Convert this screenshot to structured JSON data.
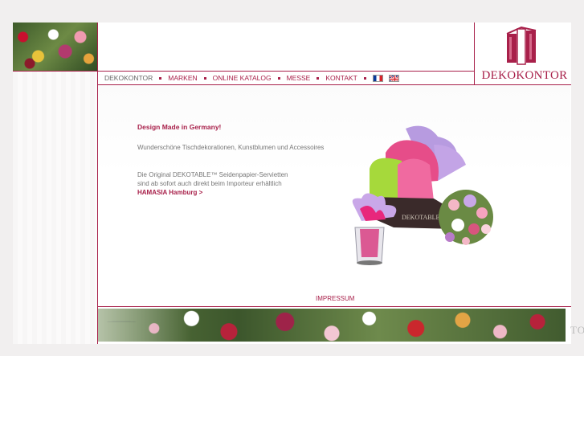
{
  "brand": {
    "logo_text": "DEKOKONTOR",
    "accent_color": "#a8204a"
  },
  "nav": {
    "items": [
      {
        "label": "DEKOKONTOR",
        "active": true
      },
      {
        "label": "MARKEN",
        "active": false
      },
      {
        "label": "ONLINE KATALOG",
        "active": false
      },
      {
        "label": "MESSE",
        "active": false
      },
      {
        "label": "KONTAKT",
        "active": false
      }
    ],
    "flags": [
      {
        "icon": "france-flag-icon"
      },
      {
        "icon": "uk-flag-icon"
      }
    ]
  },
  "content": {
    "headline": "Design Made in Germany!",
    "subline": "Wunderschöne Tischdekorationen, Kunstblumen und Accessoires",
    "body_line1": "Die Original DEKOTABLE™ Seidenpapier-Servietten",
    "body_line2": "sind ab sofort auch direkt beim Importeur erhältlich",
    "link": "HAMASIA Hamburg >"
  },
  "product": {
    "box_label": "DEKOTABLE"
  },
  "footer": {
    "impressum": "IMPRESSUM",
    "cut_text": "TO"
  }
}
